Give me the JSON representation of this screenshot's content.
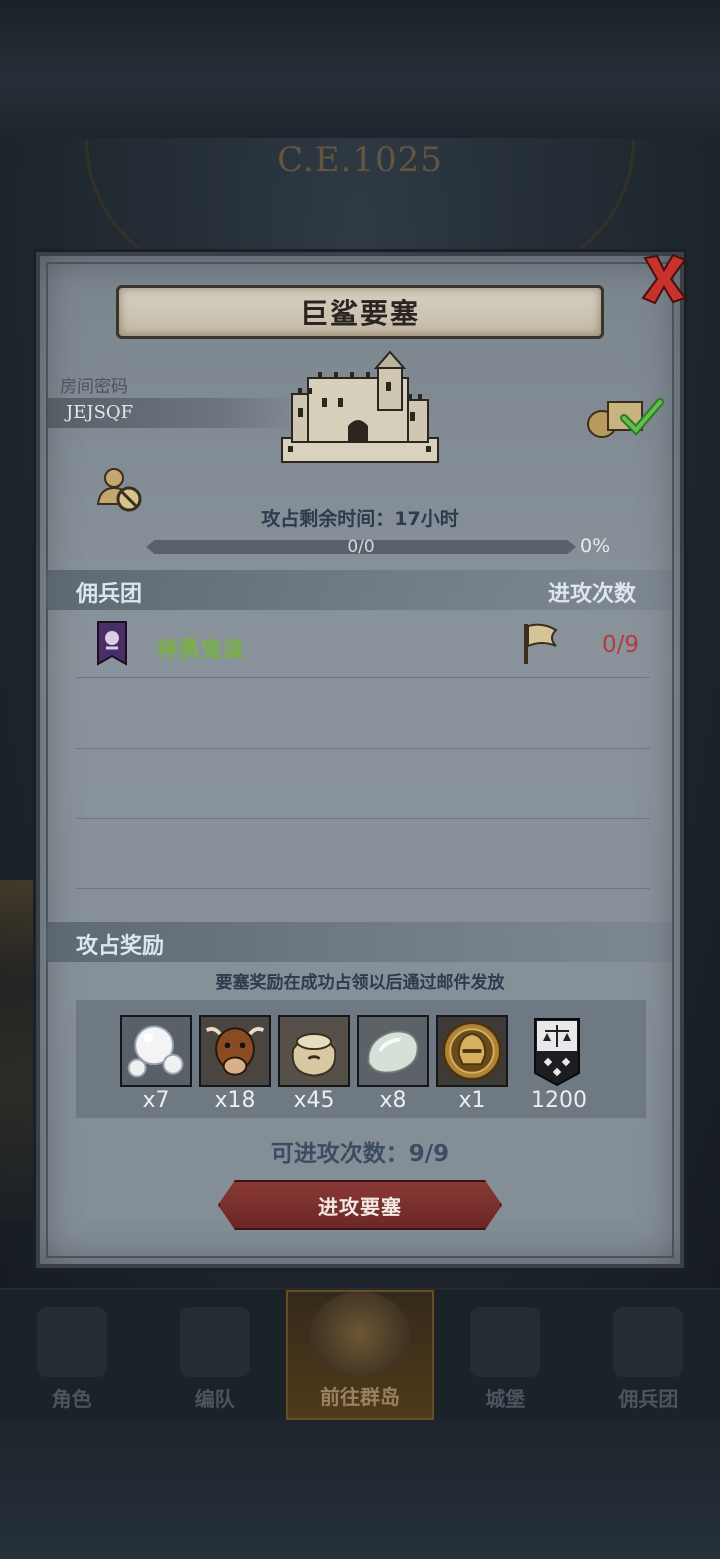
{
  "backdrop": {
    "year": "C.E.1025"
  },
  "dialog": {
    "title": "巨鲨要塞",
    "room": {
      "label": "房间密码",
      "code": "JEJSQF"
    },
    "time_remaining": "攻占剩余时间：17小时",
    "progress": {
      "text": "0/0",
      "percent_label": "0%",
      "fraction": 0.0
    },
    "guild_section": {
      "left_header": "佣兵团",
      "right_header": "进攻次数",
      "rows": [
        {
          "name": "神勇鬼谋",
          "attacks": "0/9"
        }
      ]
    },
    "rewards_section": {
      "header": "攻占奖励",
      "note": "要塞奖励在成功占领以后通过邮件发放",
      "items": [
        {
          "icon": "pearls-icon",
          "count": "x7"
        },
        {
          "icon": "cattle-icon",
          "count": "x18"
        },
        {
          "icon": "grain-sack-icon",
          "count": "x45"
        },
        {
          "icon": "moonstone-icon",
          "count": "x8"
        },
        {
          "icon": "helmet-medal-icon",
          "count": "x1"
        },
        {
          "icon": "justice-banner-icon",
          "count": "1200"
        }
      ]
    },
    "attack_count": "可进攻次数：9/9",
    "attack_button": "进攻要塞"
  },
  "bottom_nav": {
    "items": [
      {
        "label": "角色"
      },
      {
        "label": "编队"
      },
      {
        "label": "前往群岛"
      },
      {
        "label": "城堡"
      },
      {
        "label": "佣兵团"
      }
    ],
    "active_index": 2
  },
  "colors": {
    "guild_name": "#79b04a",
    "attacks_count": "#b23c3c",
    "attack_button": "#7a302d"
  }
}
